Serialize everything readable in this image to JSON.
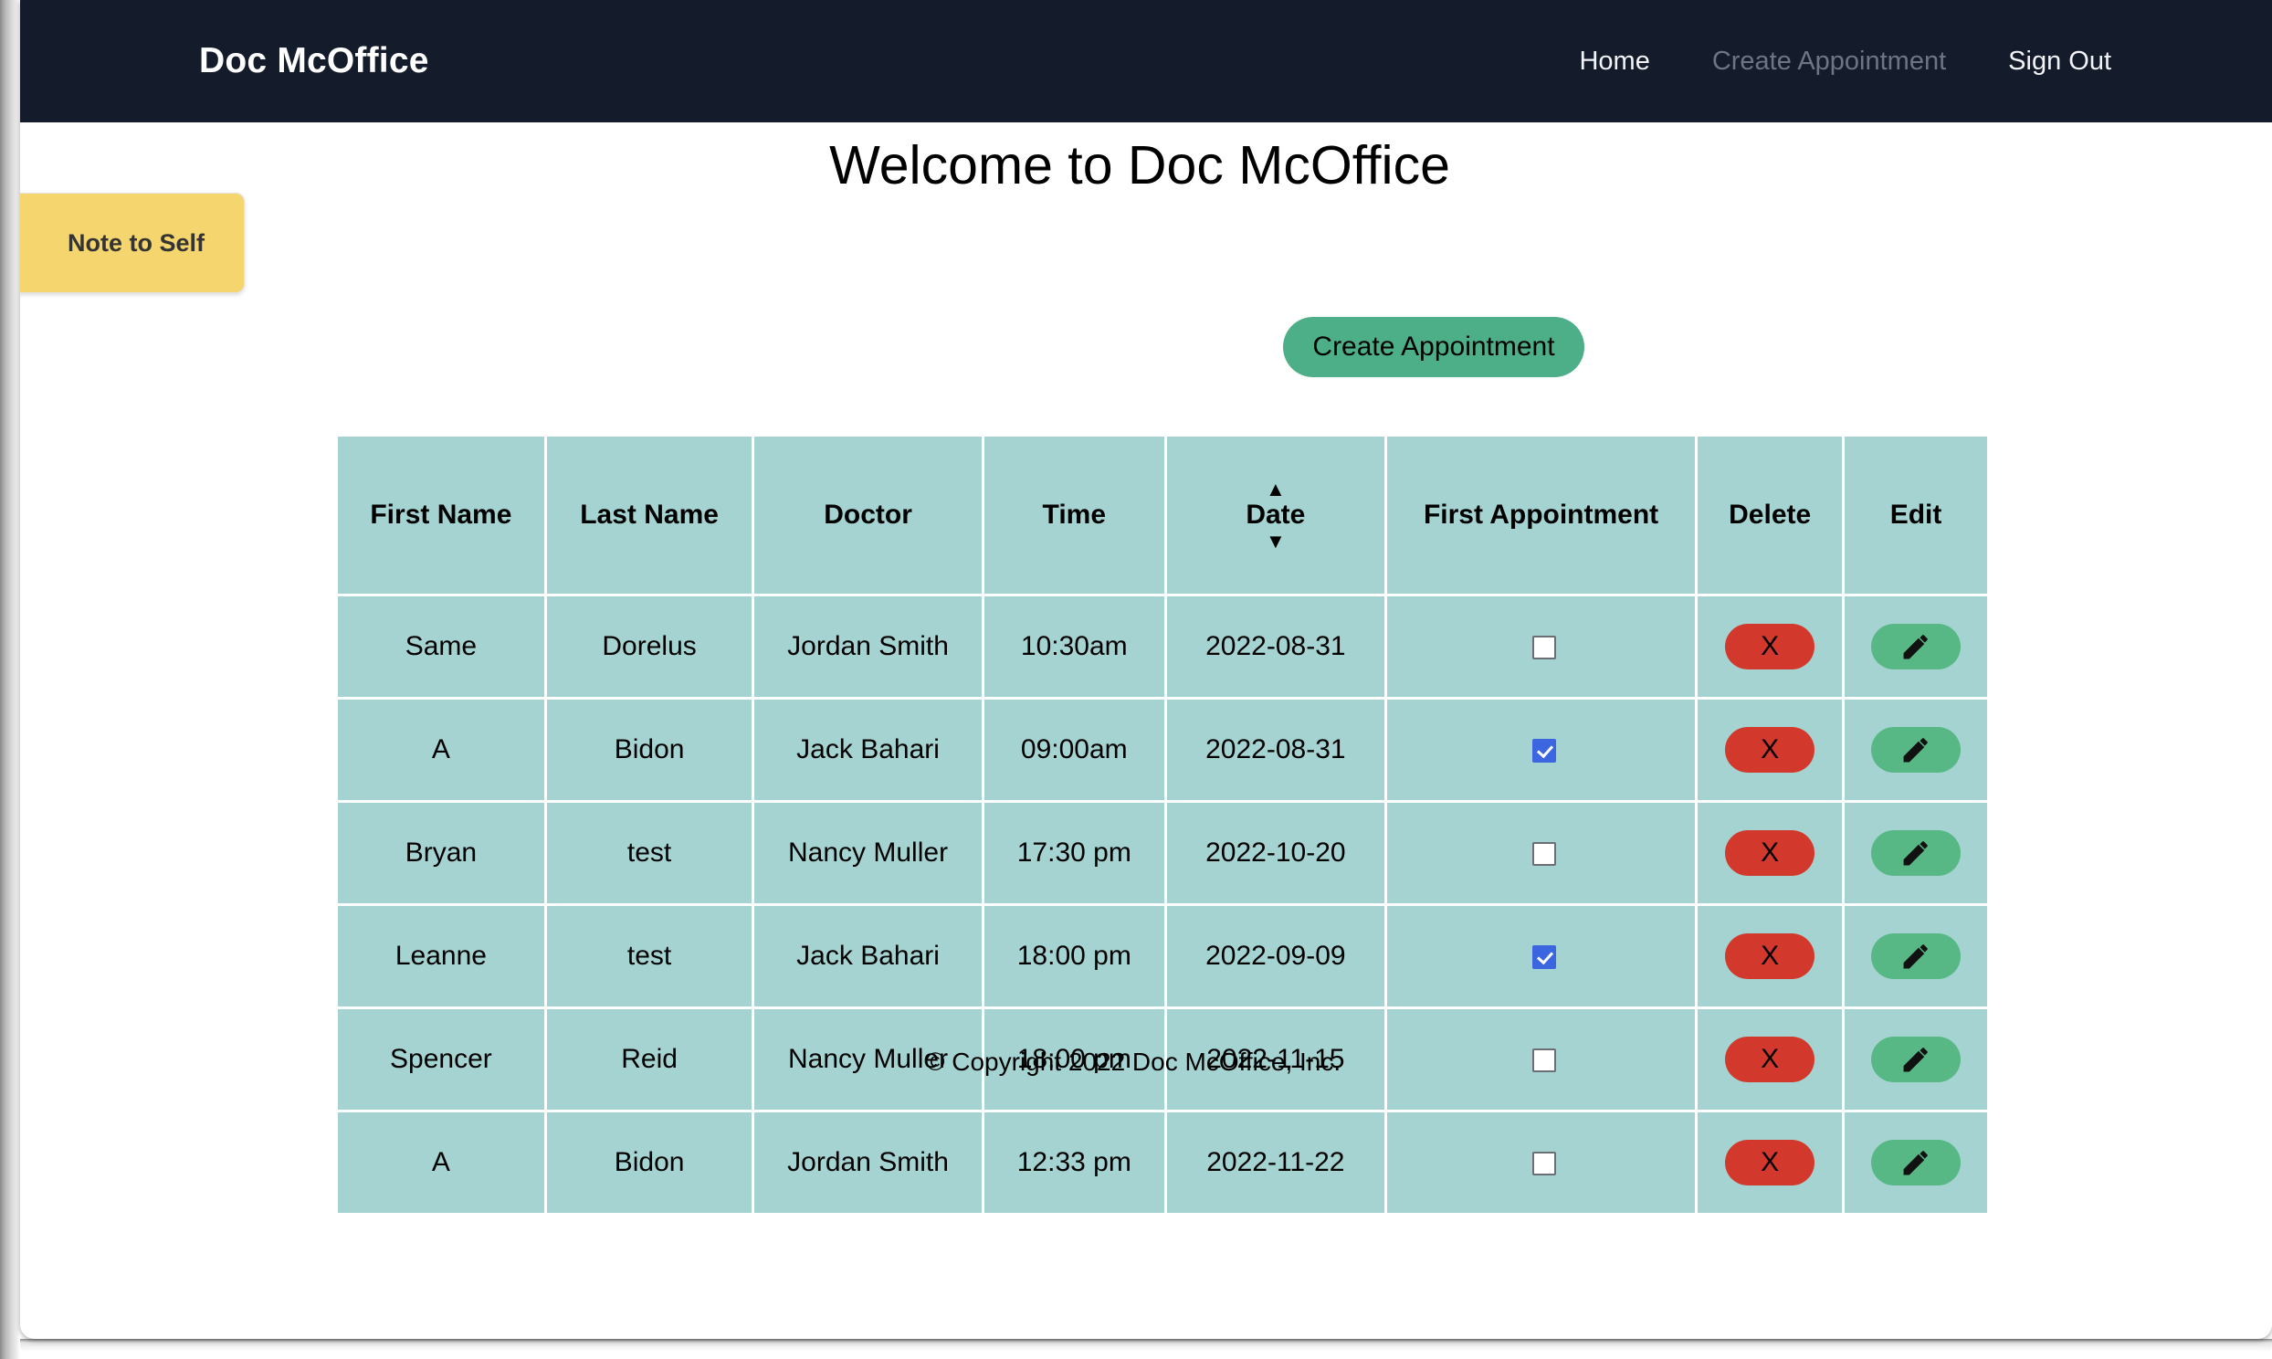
{
  "navbar": {
    "brand": "Doc McOffice",
    "links": [
      {
        "label": "Home",
        "state": "active"
      },
      {
        "label": "Create Appointment",
        "state": "dim"
      },
      {
        "label": "Sign Out",
        "state": "normal"
      }
    ]
  },
  "page": {
    "title": "Welcome to Doc McOffice",
    "note_card_label": "Note to Self",
    "create_appointment_button": "Create Appointment"
  },
  "table": {
    "headers": {
      "first_name": "First Name",
      "last_name": "Last Name",
      "doctor": "Doctor",
      "time": "Time",
      "date": "Date",
      "first_appointment": "First Appointment",
      "delete": "Delete",
      "edit": "Edit"
    },
    "sort": {
      "column": "Date",
      "asc_arrow": "▲",
      "desc_arrow": "▼"
    },
    "delete_label": "X",
    "edit_icon": "pencil-icon",
    "rows": [
      {
        "first_name": "Same",
        "last_name": "Dorelus",
        "doctor": "Jordan Smith",
        "time": "10:30am",
        "date": "2022-08-31",
        "first_appointment": false
      },
      {
        "first_name": "A",
        "last_name": "Bidon",
        "doctor": "Jack Bahari",
        "time": "09:00am",
        "date": "2022-08-31",
        "first_appointment": true
      },
      {
        "first_name": "Bryan",
        "last_name": "test",
        "doctor": "Nancy Muller",
        "time": "17:30 pm",
        "date": "2022-10-20",
        "first_appointment": false
      },
      {
        "first_name": "Leanne",
        "last_name": "test",
        "doctor": "Jack Bahari",
        "time": "18:00 pm",
        "date": "2022-09-09",
        "first_appointment": true
      },
      {
        "first_name": "Spencer",
        "last_name": "Reid",
        "doctor": "Nancy Muller",
        "time": "18:00 pm",
        "date": "2022-11-15",
        "first_appointment": false
      },
      {
        "first_name": "A",
        "last_name": "Bidon",
        "doctor": "Jordan Smith",
        "time": "12:33 pm",
        "date": "2022-11-22",
        "first_appointment": false
      }
    ]
  },
  "footer": {
    "copyright": "© Copyright 2022 Doc McOffice, Inc."
  },
  "colors": {
    "navbar_bg": "#141b2a",
    "table_cell_bg": "#a5d3d1",
    "note_bg": "#f5d66e",
    "accent_green": "#4caf87",
    "edit_green": "#57b885",
    "delete_red": "#d2382c",
    "checkbox_blue": "#3b66e0"
  }
}
